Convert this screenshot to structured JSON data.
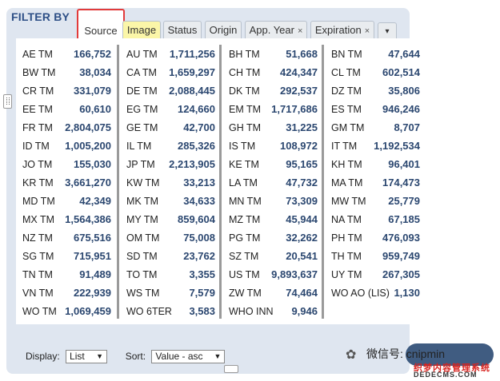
{
  "header": {
    "title": "FILTER BY"
  },
  "tabs": [
    {
      "label": "Source",
      "closable": false
    },
    {
      "label": "Image",
      "closable": false
    },
    {
      "label": "Status",
      "closable": false
    },
    {
      "label": "Origin",
      "closable": false
    },
    {
      "label": "App. Year",
      "closable": true
    },
    {
      "label": "Expiration",
      "closable": true
    }
  ],
  "close_glyph": "×",
  "more_glyph": "▾",
  "columns": [
    [
      {
        "label": "AE TM",
        "value": "166,752"
      },
      {
        "label": "BW TM",
        "value": "38,034"
      },
      {
        "label": "CR TM",
        "value": "331,079"
      },
      {
        "label": "EE TM",
        "value": "60,610"
      },
      {
        "label": "FR TM",
        "value": "2,804,075"
      },
      {
        "label": "ID TM",
        "value": "1,005,200"
      },
      {
        "label": "JO TM",
        "value": "155,030"
      },
      {
        "label": "KR TM",
        "value": "3,661,270"
      },
      {
        "label": "MD TM",
        "value": "42,349"
      },
      {
        "label": "MX TM",
        "value": "1,564,386"
      },
      {
        "label": "NZ TM",
        "value": "675,516"
      },
      {
        "label": "SG TM",
        "value": "715,951"
      },
      {
        "label": "TN TM",
        "value": "91,489"
      },
      {
        "label": "VN TM",
        "value": "222,939"
      },
      {
        "label": "WO TM",
        "value": "1,069,459"
      }
    ],
    [
      {
        "label": "AU TM",
        "value": "1,711,256"
      },
      {
        "label": "CA TM",
        "value": "1,659,297"
      },
      {
        "label": "DE TM",
        "value": "2,088,445"
      },
      {
        "label": "EG TM",
        "value": "124,660"
      },
      {
        "label": "GE TM",
        "value": "42,700"
      },
      {
        "label": "IL TM",
        "value": "285,326"
      },
      {
        "label": "JP TM",
        "value": "2,213,905"
      },
      {
        "label": "KW TM",
        "value": "33,213"
      },
      {
        "label": "MK TM",
        "value": "34,633"
      },
      {
        "label": "MY TM",
        "value": "859,604"
      },
      {
        "label": "OM TM",
        "value": "75,008"
      },
      {
        "label": "SD TM",
        "value": "23,762"
      },
      {
        "label": "TO TM",
        "value": "3,355"
      },
      {
        "label": "WS TM",
        "value": "7,579"
      },
      {
        "label": "WO 6TER",
        "value": "3,583"
      }
    ],
    [
      {
        "label": "BH TM",
        "value": "51,668"
      },
      {
        "label": "CH TM",
        "value": "424,347"
      },
      {
        "label": "DK TM",
        "value": "292,537"
      },
      {
        "label": "EM TM",
        "value": "1,717,686"
      },
      {
        "label": "GH TM",
        "value": "31,225"
      },
      {
        "label": "IS TM",
        "value": "108,972"
      },
      {
        "label": "KE TM",
        "value": "95,165"
      },
      {
        "label": "LA TM",
        "value": "47,732"
      },
      {
        "label": "MN TM",
        "value": "73,309"
      },
      {
        "label": "MZ TM",
        "value": "45,944"
      },
      {
        "label": "PG TM",
        "value": "32,262"
      },
      {
        "label": "SZ TM",
        "value": "20,541"
      },
      {
        "label": "US TM",
        "value": "9,893,637"
      },
      {
        "label": "ZW TM",
        "value": "74,464"
      },
      {
        "label": "WHO INN",
        "value": "9,946"
      }
    ],
    [
      {
        "label": "BN TM",
        "value": "47,644"
      },
      {
        "label": "CL TM",
        "value": "602,514"
      },
      {
        "label": "DZ TM",
        "value": "35,806"
      },
      {
        "label": "ES TM",
        "value": "946,246"
      },
      {
        "label": "GM TM",
        "value": "8,707"
      },
      {
        "label": "IT TM",
        "value": "1,192,534"
      },
      {
        "label": "KH TM",
        "value": "96,401"
      },
      {
        "label": "MA TM",
        "value": "174,473"
      },
      {
        "label": "MW TM",
        "value": "25,779"
      },
      {
        "label": "NA TM",
        "value": "67,185"
      },
      {
        "label": "PH TM",
        "value": "476,093"
      },
      {
        "label": "TH TM",
        "value": "959,749"
      },
      {
        "label": "UY TM",
        "value": "267,305"
      },
      {
        "label": "WO AO (LIS)",
        "value": "1,130"
      }
    ]
  ],
  "footer": {
    "display_label": "Display:",
    "display_value": "List",
    "sort_label": "Sort:",
    "sort_value": "Value - asc"
  },
  "watermark": {
    "text": "微信号: cnipmin",
    "red_text": "织梦内容管理系统",
    "url": "DEDECMS.COM"
  }
}
